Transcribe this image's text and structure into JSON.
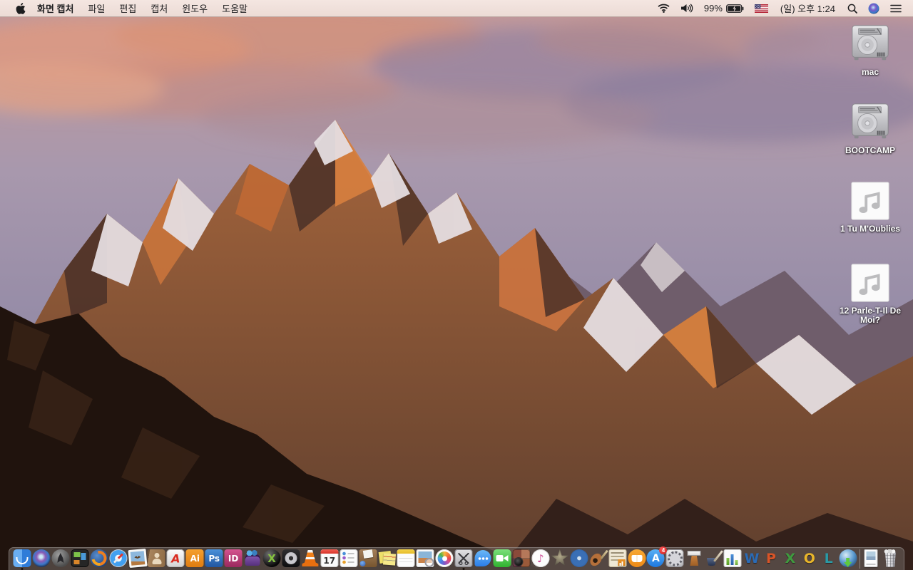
{
  "menu_bar": {
    "app_name": "화면 캡처",
    "menus": [
      "파일",
      "편집",
      "캡처",
      "윈도우",
      "도움말"
    ],
    "status": {
      "battery_percent": "99%",
      "clock": "(일) 오후 1:24"
    }
  },
  "desktop": {
    "icons": [
      {
        "name": "volume-mac",
        "type": "hdd",
        "label": "mac"
      },
      {
        "name": "volume-bootcamp",
        "type": "hdd",
        "label": "BOOTCAMP"
      },
      {
        "name": "audio-file-1",
        "type": "audio",
        "label": "1 Tu M'Oublies"
      },
      {
        "name": "audio-file-2",
        "type": "audio",
        "label": "12 Parle-T-Il De Moi?"
      }
    ]
  },
  "dock": {
    "items": [
      {
        "name": "finder",
        "cls": "i-finder",
        "running": true
      },
      {
        "name": "siri",
        "cls": "i-siri"
      },
      {
        "name": "launchpad",
        "cls": "i-launchpad"
      },
      {
        "name": "mission-control",
        "cls": "i-mission-control"
      },
      {
        "name": "firefox",
        "cls": "i-firefox"
      },
      {
        "name": "safari",
        "cls": "i-safari"
      },
      {
        "name": "mail",
        "cls": "i-mail"
      },
      {
        "name": "contacts",
        "cls": "i-contacts"
      },
      {
        "name": "acrobat-reader",
        "cls": "i-acrobat",
        "glyph": "A"
      },
      {
        "name": "illustrator",
        "cls": "i-illustrator",
        "glyph": "Ai"
      },
      {
        "name": "photoshop",
        "cls": "i-photoshop",
        "glyph": "Ps"
      },
      {
        "name": "indesign",
        "cls": "i-indesign",
        "glyph": "ID"
      },
      {
        "name": "toast-titanium",
        "cls": "i-toast"
      },
      {
        "name": "x-sphere-app",
        "cls": "i-xsphere",
        "glyph": "X"
      },
      {
        "name": "disk-utility-app",
        "cls": "i-disktool"
      },
      {
        "name": "vlc",
        "cls": "i-vlc"
      },
      {
        "name": "calendar",
        "cls": "i-calendar",
        "glyph": "17"
      },
      {
        "name": "reminders",
        "cls": "i-reminders"
      },
      {
        "name": "stuffit-expander",
        "cls": "i-stuffit"
      },
      {
        "name": "stickies",
        "cls": "i-stickies"
      },
      {
        "name": "notes",
        "cls": "i-notes"
      },
      {
        "name": "preview",
        "cls": "i-preview"
      },
      {
        "name": "photos",
        "cls": "i-photos"
      },
      {
        "name": "grab-screen-capture",
        "cls": "i-grab",
        "running": true
      },
      {
        "name": "messages",
        "cls": "i-messages"
      },
      {
        "name": "facetime",
        "cls": "i-facetime"
      },
      {
        "name": "photo-booth",
        "cls": "i-photobooth"
      },
      {
        "name": "itunes",
        "cls": "i-itunes",
        "glyph": "♪"
      },
      {
        "name": "imovie",
        "cls": "i-imovie"
      },
      {
        "name": "idvd",
        "cls": "i-idvd"
      },
      {
        "name": "garageband",
        "cls": "i-garageband"
      },
      {
        "name": "newsstand-documents",
        "cls": "i-newsstand"
      },
      {
        "name": "ibooks",
        "cls": "i-ibooks"
      },
      {
        "name": "app-store",
        "cls": "i-appstore",
        "glyph": "A",
        "badge": "4"
      },
      {
        "name": "system-preferences",
        "cls": "i-sysprefs"
      },
      {
        "name": "keynote",
        "cls": "i-keynote"
      },
      {
        "name": "pages",
        "cls": "i-pages"
      },
      {
        "name": "numbers",
        "cls": "i-numbers"
      },
      {
        "name": "word",
        "cls": "i-word",
        "glyph": "W"
      },
      {
        "name": "powerpoint",
        "cls": "i-powerpoint",
        "glyph": "P"
      },
      {
        "name": "excel",
        "cls": "i-excel",
        "glyph": "X"
      },
      {
        "name": "outlook",
        "cls": "i-outlook",
        "glyph": "O"
      },
      {
        "name": "lync",
        "cls": "i-lync",
        "glyph": "L"
      },
      {
        "name": "web-downloader",
        "cls": "i-downloader"
      },
      {
        "name": "divider",
        "divider": true
      },
      {
        "name": "document-file",
        "cls": "i-docfile"
      },
      {
        "name": "trash-full",
        "cls": "i-trash"
      }
    ]
  }
}
